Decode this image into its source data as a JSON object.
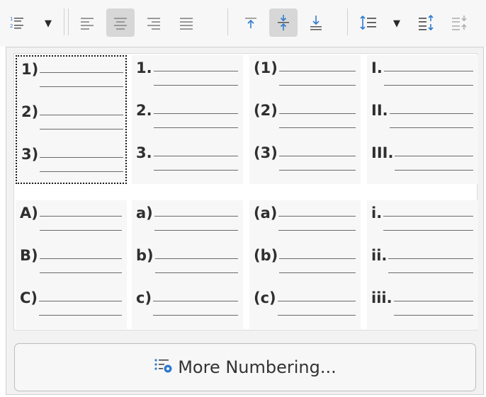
{
  "toolbar": {
    "buttons": [
      {
        "name": "numbering-toggle-icon"
      },
      {
        "name": "align-left-icon"
      },
      {
        "name": "align-center-icon"
      },
      {
        "name": "align-right-icon"
      },
      {
        "name": "justify-icon"
      },
      {
        "name": "align-top-icon"
      },
      {
        "name": "center-vertically-icon"
      },
      {
        "name": "align-bottom-icon"
      },
      {
        "name": "line-spacing-icon"
      },
      {
        "name": "increase-paragraph-spacing-icon"
      },
      {
        "name": "decrease-paragraph-spacing-icon"
      }
    ],
    "dropdown_glyph": "▼"
  },
  "numbering_presets": [
    {
      "labels": [
        "1)",
        "2)",
        "3)"
      ],
      "selected": true
    },
    {
      "labels": [
        "1.",
        "2.",
        "3."
      ],
      "selected": false
    },
    {
      "labels": [
        "(1)",
        "(2)",
        "(3)"
      ],
      "selected": false
    },
    {
      "labels": [
        "I.",
        "II.",
        "III."
      ],
      "selected": false
    },
    {
      "labels": [
        "A)",
        "B)",
        "C)"
      ],
      "selected": false
    },
    {
      "labels": [
        "a)",
        "b)",
        "c)"
      ],
      "selected": false
    },
    {
      "labels": [
        "(a)",
        "(b)",
        "(c)"
      ],
      "selected": false
    },
    {
      "labels": [
        "i.",
        "ii.",
        "iii."
      ],
      "selected": false
    }
  ],
  "more_button": {
    "label": "More Numbering..."
  },
  "colors": {
    "active_button": "#d7d7d7",
    "accent_blue": "#2e7bcf",
    "text": "#2f2f2f"
  }
}
